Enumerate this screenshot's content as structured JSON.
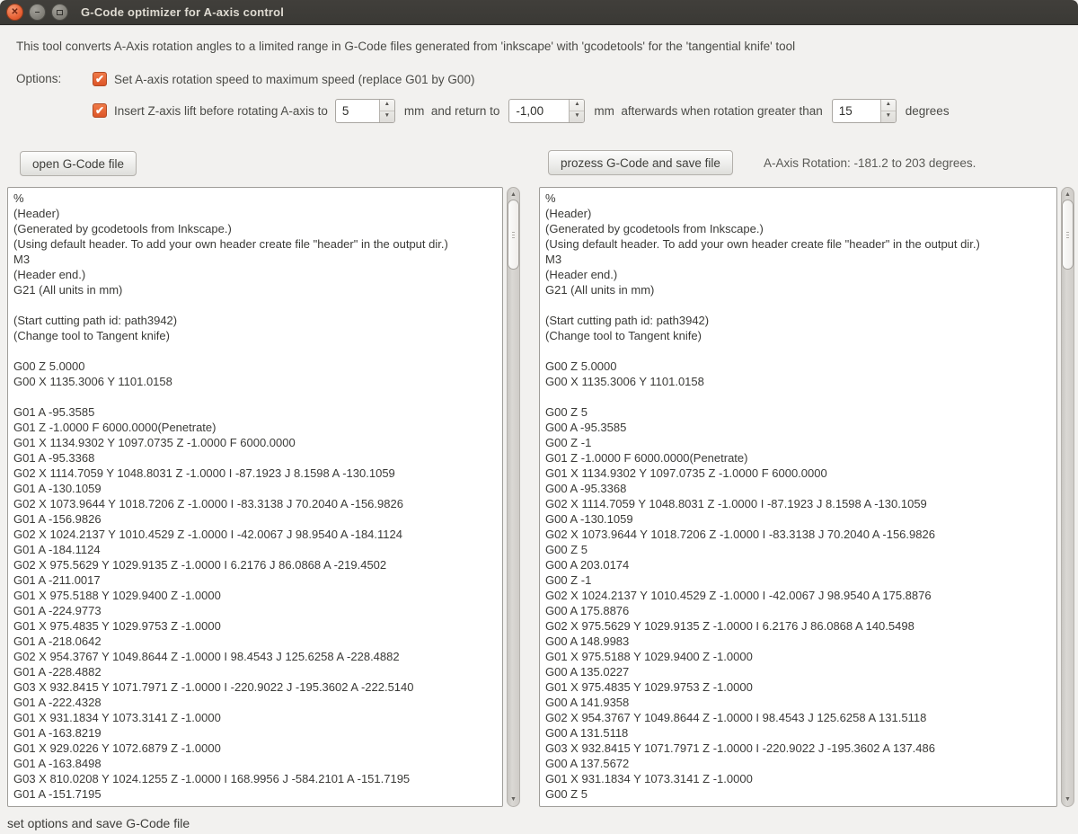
{
  "window": {
    "title": "G-Code optimizer for A-axis control",
    "description": "This tool converts A-Axis rotation angles to a limited range in G-Code files generated from 'inkscape' with 'gcodetools' for the 'tangential knife' tool",
    "status_text": "set options and save G-Code file"
  },
  "icons": {
    "close": "✕",
    "minimize": "–",
    "checkbox_check": "✔",
    "spinner_up": "▲",
    "spinner_down": "▼",
    "scroll_up": "▲",
    "scroll_down": "▼"
  },
  "colors": {
    "accent_orange": "#e9663a",
    "titlebar_bg": "#3a3935",
    "window_bg": "#f2f1ef",
    "pane_bg": "#ffffff"
  },
  "options": {
    "label": "Options:",
    "option1": {
      "checked": true,
      "label": "Set A-axis rotation speed to maximum speed (replace G01 by G00)"
    },
    "option2": {
      "checked": true,
      "text_lift": "Insert Z-axis lift before rotating A-axis to",
      "lift_value": "5",
      "text_return": "mm  and return to",
      "return_value": "-1,00",
      "text_angle": "mm  afterwards when rotation greater than",
      "angle_value": "15",
      "text_degrees": "degrees"
    }
  },
  "toolbar": {
    "open_button": "open G-Code file",
    "process_button": "prozess G-Code and save file",
    "rotation_info": "A-Axis Rotation: -181.2 to 203 degrees."
  },
  "source_gcode": {
    "lines": [
      "%",
      "(Header)",
      "(Generated by gcodetools from Inkscape.)",
      "(Using default header. To add your own header create file \"header\" in the output dir.)",
      "M3",
      "(Header end.)",
      "G21 (All units in mm)",
      "",
      "(Start cutting path id: path3942)",
      "(Change tool to Tangent knife)",
      "",
      "G00 Z 5.0000",
      "G00 X 1135.3006 Y 1101.0158",
      "",
      "G01 A -95.3585",
      "G01 Z -1.0000 F 6000.0000(Penetrate)",
      "G01 X 1134.9302 Y 1097.0735 Z -1.0000 F 6000.0000",
      "G01 A -95.3368",
      "G02 X 1114.7059 Y 1048.8031 Z -1.0000 I -87.1923 J 8.1598 A -130.1059",
      "G01 A -130.1059",
      "G02 X 1073.9644 Y 1018.7206 Z -1.0000 I -83.3138 J 70.2040 A -156.9826",
      "G01 A -156.9826",
      "G02 X 1024.2137 Y 1010.4529 Z -1.0000 I -42.0067 J 98.9540 A -184.1124",
      "G01 A -184.1124",
      "G02 X 975.5629 Y 1029.9135 Z -1.0000 I 6.2176 J 86.0868 A -219.4502",
      "G01 A -211.0017",
      "G01 X 975.5188 Y 1029.9400 Z -1.0000",
      "G01 A -224.9773",
      "G01 X 975.4835 Y 1029.9753 Z -1.0000",
      "G01 A -218.0642",
      "G02 X 954.3767 Y 1049.8644 Z -1.0000 I 98.4543 J 125.6258 A -228.4882",
      "G01 A -228.4882",
      "G03 X 932.8415 Y 1071.7971 Z -1.0000 I -220.9022 J -195.3602 A -222.5140",
      "G01 A -222.4328",
      "G01 X 931.1834 Y 1073.3141 Z -1.0000",
      "G01 A -163.8219",
      "G01 X 929.0226 Y 1072.6879 Z -1.0000",
      "G01 A -163.8498",
      "G03 X 810.0208 Y 1024.1255 Z -1.0000 I 168.9956 J -584.2101 A -151.7195",
      "G01 A -151.7195"
    ]
  },
  "output_gcode": {
    "lines": [
      "%",
      "(Header)",
      "(Generated by gcodetools from Inkscape.)",
      "(Using default header. To add your own header create file \"header\" in the output dir.)",
      "M3",
      "(Header end.)",
      "G21 (All units in mm)",
      "",
      "(Start cutting path id: path3942)",
      "(Change tool to Tangent knife)",
      "",
      "G00 Z 5.0000",
      "G00 X 1135.3006 Y 1101.0158",
      "",
      "G00 Z 5",
      "G00 A -95.3585",
      "G00 Z -1",
      "G01 Z -1.0000 F 6000.0000(Penetrate)",
      "G01 X 1134.9302 Y 1097.0735 Z -1.0000 F 6000.0000",
      "G00 A -95.3368",
      "G02 X 1114.7059 Y 1048.8031 Z -1.0000 I -87.1923 J 8.1598 A -130.1059",
      "G00 A -130.1059",
      "G02 X 1073.9644 Y 1018.7206 Z -1.0000 I -83.3138 J 70.2040 A -156.9826",
      "G00 Z 5",
      "G00 A 203.0174",
      "G00 Z -1",
      "G02 X 1024.2137 Y 1010.4529 Z -1.0000 I -42.0067 J 98.9540 A 175.8876",
      "G00 A 175.8876",
      "G02 X 975.5629 Y 1029.9135 Z -1.0000 I 6.2176 J 86.0868 A 140.5498",
      "G00 A 148.9983",
      "G01 X 975.5188 Y 1029.9400 Z -1.0000",
      "G00 A 135.0227",
      "G01 X 975.4835 Y 1029.9753 Z -1.0000",
      "G00 A 141.9358",
      "G02 X 954.3767 Y 1049.8644 Z -1.0000 I 98.4543 J 125.6258 A 131.5118",
      "G00 A 131.5118",
      "G03 X 932.8415 Y 1071.7971 Z -1.0000 I -220.9022 J -195.3602 A 137.486",
      "G00 A 137.5672",
      "G01 X 931.1834 Y 1073.3141 Z -1.0000",
      "G00 Z 5"
    ]
  }
}
